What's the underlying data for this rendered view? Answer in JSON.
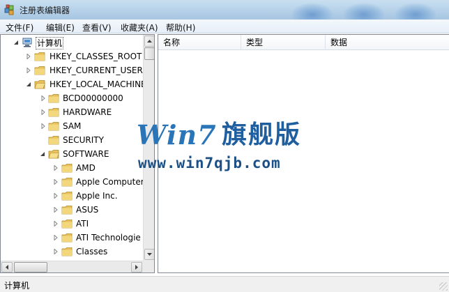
{
  "window": {
    "title": "注册表编辑器",
    "app_icon": "regedit-icon"
  },
  "menu": [
    "文件(F)",
    "编辑(E)",
    "查看(V)",
    "收藏夹(A)",
    "帮助(H)"
  ],
  "tree": {
    "root": "计算机",
    "items": [
      {
        "label": "HKEY_CLASSES_ROOT",
        "expanded": false
      },
      {
        "label": "HKEY_CURRENT_USER",
        "expanded": false
      },
      {
        "label": "HKEY_LOCAL_MACHINE",
        "expanded": true
      },
      {
        "label": "BCD00000000",
        "expanded": false
      },
      {
        "label": "HARDWARE",
        "expanded": false
      },
      {
        "label": "SAM",
        "expanded": false
      },
      {
        "label": "SECURITY",
        "expanded": false
      },
      {
        "label": "SOFTWARE",
        "expanded": true
      },
      {
        "label": "AMD",
        "expanded": false
      },
      {
        "label": "Apple Computer",
        "expanded": false
      },
      {
        "label": "Apple Inc.",
        "expanded": false
      },
      {
        "label": "ASUS",
        "expanded": false
      },
      {
        "label": "ATI",
        "expanded": false
      },
      {
        "label": "ATI Technologie",
        "expanded": false
      },
      {
        "label": "Classes",
        "expanded": false
      }
    ]
  },
  "list": {
    "columns": [
      "名称",
      "类型",
      "数据"
    ]
  },
  "statusbar": {
    "text": "计算机"
  },
  "watermark": {
    "brand": "Win7",
    "brand_cn": "旗舰版",
    "url": "www.win7qjb.com"
  },
  "colors": {
    "folder": "#e8c15a",
    "watermark": "#2a74b8",
    "titlebar": "#b9d3ea"
  }
}
